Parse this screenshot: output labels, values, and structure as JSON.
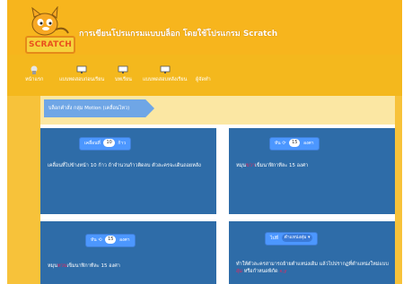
{
  "header": {
    "logo_text": "SCRATCH",
    "site_title": "การเขียนโปรแกรมแบบบล็อก โดยใช้โปรแกรม Scratch",
    "bg_color": "#f7b51d"
  },
  "nav": {
    "items": [
      {
        "label": "หน้าแรก",
        "icon": "home-icon"
      },
      {
        "label": "แบบทดสอบก่อนเรียน",
        "icon": "monitor-icon"
      },
      {
        "label": "บทเรียน",
        "icon": "monitor-icon"
      },
      {
        "label": "แบบทดสอบหลังเรียน",
        "icon": "monitor-icon"
      },
      {
        "label": "ผู้จัดทำ",
        "icon": ""
      }
    ]
  },
  "breadcrumb": {
    "label": "บล็อกคำสั่ง กลุ่ม Motion (เคลื่อนไหว)"
  },
  "cards": [
    {
      "block_prefix": "เคลื่อนที่",
      "block_value": "10",
      "block_suffix": "ก้าว",
      "description": "เคลื่อนที่ไปข้างหน้า 10 ก้าว ถ้าจำนวนก้าวติดลบ ตัวละครจะเดินถอยหลัง"
    },
    {
      "block_prefix": "หัน",
      "block_arrow": "⟳",
      "block_value": "15",
      "block_suffix": "องศา",
      "desc_before": "หมุน",
      "desc_highlight": "ขวา",
      "desc_after": "เข็มนาฬิกาทีละ 15 องศา"
    },
    {
      "block_prefix": "หัน",
      "block_arrow": "⟲",
      "block_value": "15",
      "block_suffix": "องศา",
      "desc_before": "หมุน",
      "desc_highlight": "ทวน",
      "desc_after": "เข็มนาฬิกาทีละ 15 องศา"
    },
    {
      "block_prefix": "ไปที่",
      "block_dropdown": "ตำแหน่งสุ่ม",
      "description_line1": "ทำให้ตัวละครสามารถย้ายตำแหน่งเดิม แล้วไปปรากฏที่ตำแหน่งใหม่แบบ",
      "desc_hl1": "สุ่ม",
      "desc_mid": " หรือกำหนดพิกัด ",
      "desc_hl2": "x,y"
    }
  ]
}
